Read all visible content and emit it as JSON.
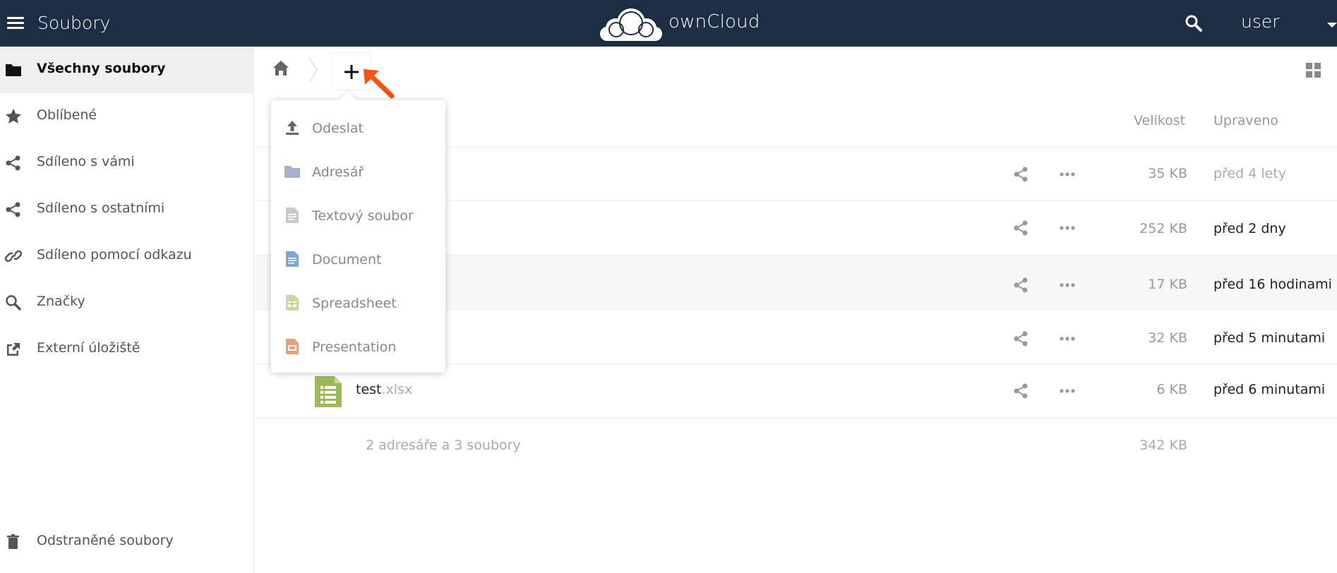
{
  "header": {
    "app_title": "Soubory",
    "brand": "ownCloud",
    "user": "user"
  },
  "sidebar": {
    "items": [
      {
        "label": "Všechny soubory",
        "icon": "folder-icon",
        "active": true
      },
      {
        "label": "Oblíbené",
        "icon": "star-icon"
      },
      {
        "label": "Sdíleno s vámi",
        "icon": "share-icon"
      },
      {
        "label": "Sdíleno s ostatními",
        "icon": "share-icon"
      },
      {
        "label": "Sdíleno pomocí odkazu",
        "icon": "link-icon"
      },
      {
        "label": "Značky",
        "icon": "search-icon"
      },
      {
        "label": "Externí úložiště",
        "icon": "external-icon"
      }
    ],
    "trash": {
      "label": "Odstraněné soubory",
      "icon": "trash-icon"
    }
  },
  "columns": {
    "size": "Velikost",
    "modified": "Upraveno"
  },
  "files": [
    {
      "size": "35 KB",
      "modified": "před 4 lety",
      "modified_state": "old"
    },
    {
      "size": "252 KB",
      "modified": "před 2 dny",
      "modified_state": "new"
    },
    {
      "size": "17 KB",
      "modified": "před 16 hodinami",
      "modified_state": "new",
      "hover": true
    },
    {
      "size": "32 KB",
      "modified": "před 5 minutami",
      "modified_state": "new"
    },
    {
      "name": "test",
      "ext": ".xlsx",
      "size": "6 KB",
      "modified": "před 6 minutami",
      "modified_state": "new",
      "icon": "spreadsheet-file-icon"
    }
  ],
  "summary": {
    "text": "2 adresáře a 3 soubory",
    "size": "342 KB"
  },
  "new_menu": {
    "items": [
      {
        "label": "Odeslat",
        "icon": "upload-icon"
      },
      {
        "label": "Adresář",
        "icon": "folder-icon"
      },
      {
        "label": "Textový soubor",
        "icon": "text-file-icon"
      },
      {
        "label": "Document",
        "icon": "document-icon"
      },
      {
        "label": "Spreadsheet",
        "icon": "spreadsheet-icon"
      },
      {
        "label": "Presentation",
        "icon": "presentation-icon"
      }
    ]
  },
  "colors": {
    "header_bg": "#1d2d44",
    "annotation_arrow": "#f4540f",
    "spreadsheet_green": "#9bbb59",
    "folder_blue": "#a4b4cc",
    "document_blue": "#7ea4d9",
    "presentation_orange": "#e8a07c"
  }
}
